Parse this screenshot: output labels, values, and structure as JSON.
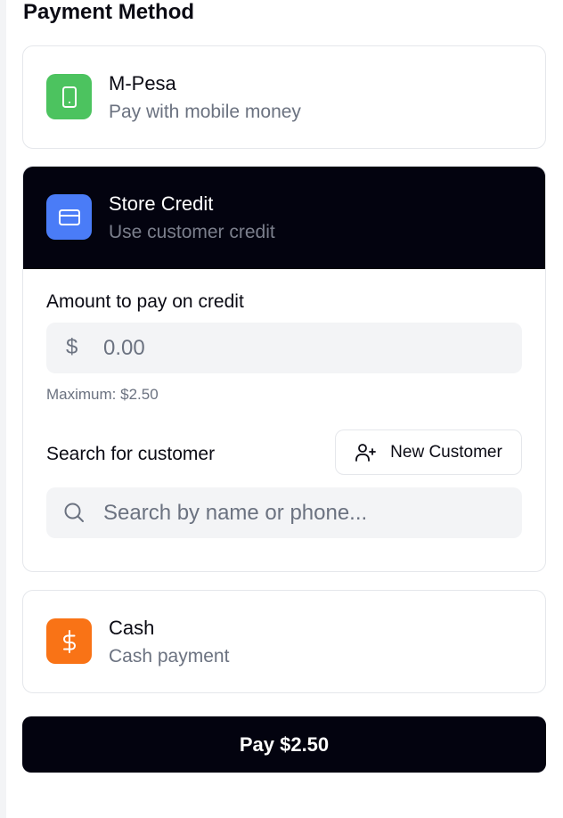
{
  "header": {
    "title": "Payment Method"
  },
  "methods": [
    {
      "id": "mpesa",
      "title": "M-Pesa",
      "subtitle": "Pay with mobile money",
      "icon": "mobile-phone-icon",
      "icon_color": "#4cc35f",
      "selected": false
    },
    {
      "id": "store_credit",
      "title": "Store Credit",
      "subtitle": "Use customer credit",
      "icon": "credit-card-icon",
      "icon_color": "#4a7cf7",
      "selected": true
    },
    {
      "id": "cash",
      "title": "Cash",
      "subtitle": "Cash payment",
      "icon": "dollar-icon",
      "icon_color": "#f97316",
      "selected": false
    }
  ],
  "credit_panel": {
    "amount_label": "Amount to pay on credit",
    "currency_symbol": "$",
    "amount_placeholder": "0.00",
    "amount_value": "",
    "maximum_hint": "Maximum: $2.50",
    "search_label": "Search for customer",
    "new_customer_label": "New Customer",
    "search_placeholder": "Search by name or phone...",
    "search_value": ""
  },
  "pay_button": {
    "label": "Pay $2.50"
  },
  "colors": {
    "primary_dark": "#03030f",
    "muted_text": "#6b7280",
    "input_bg": "#f3f4f6",
    "border": "#e5e7eb"
  }
}
